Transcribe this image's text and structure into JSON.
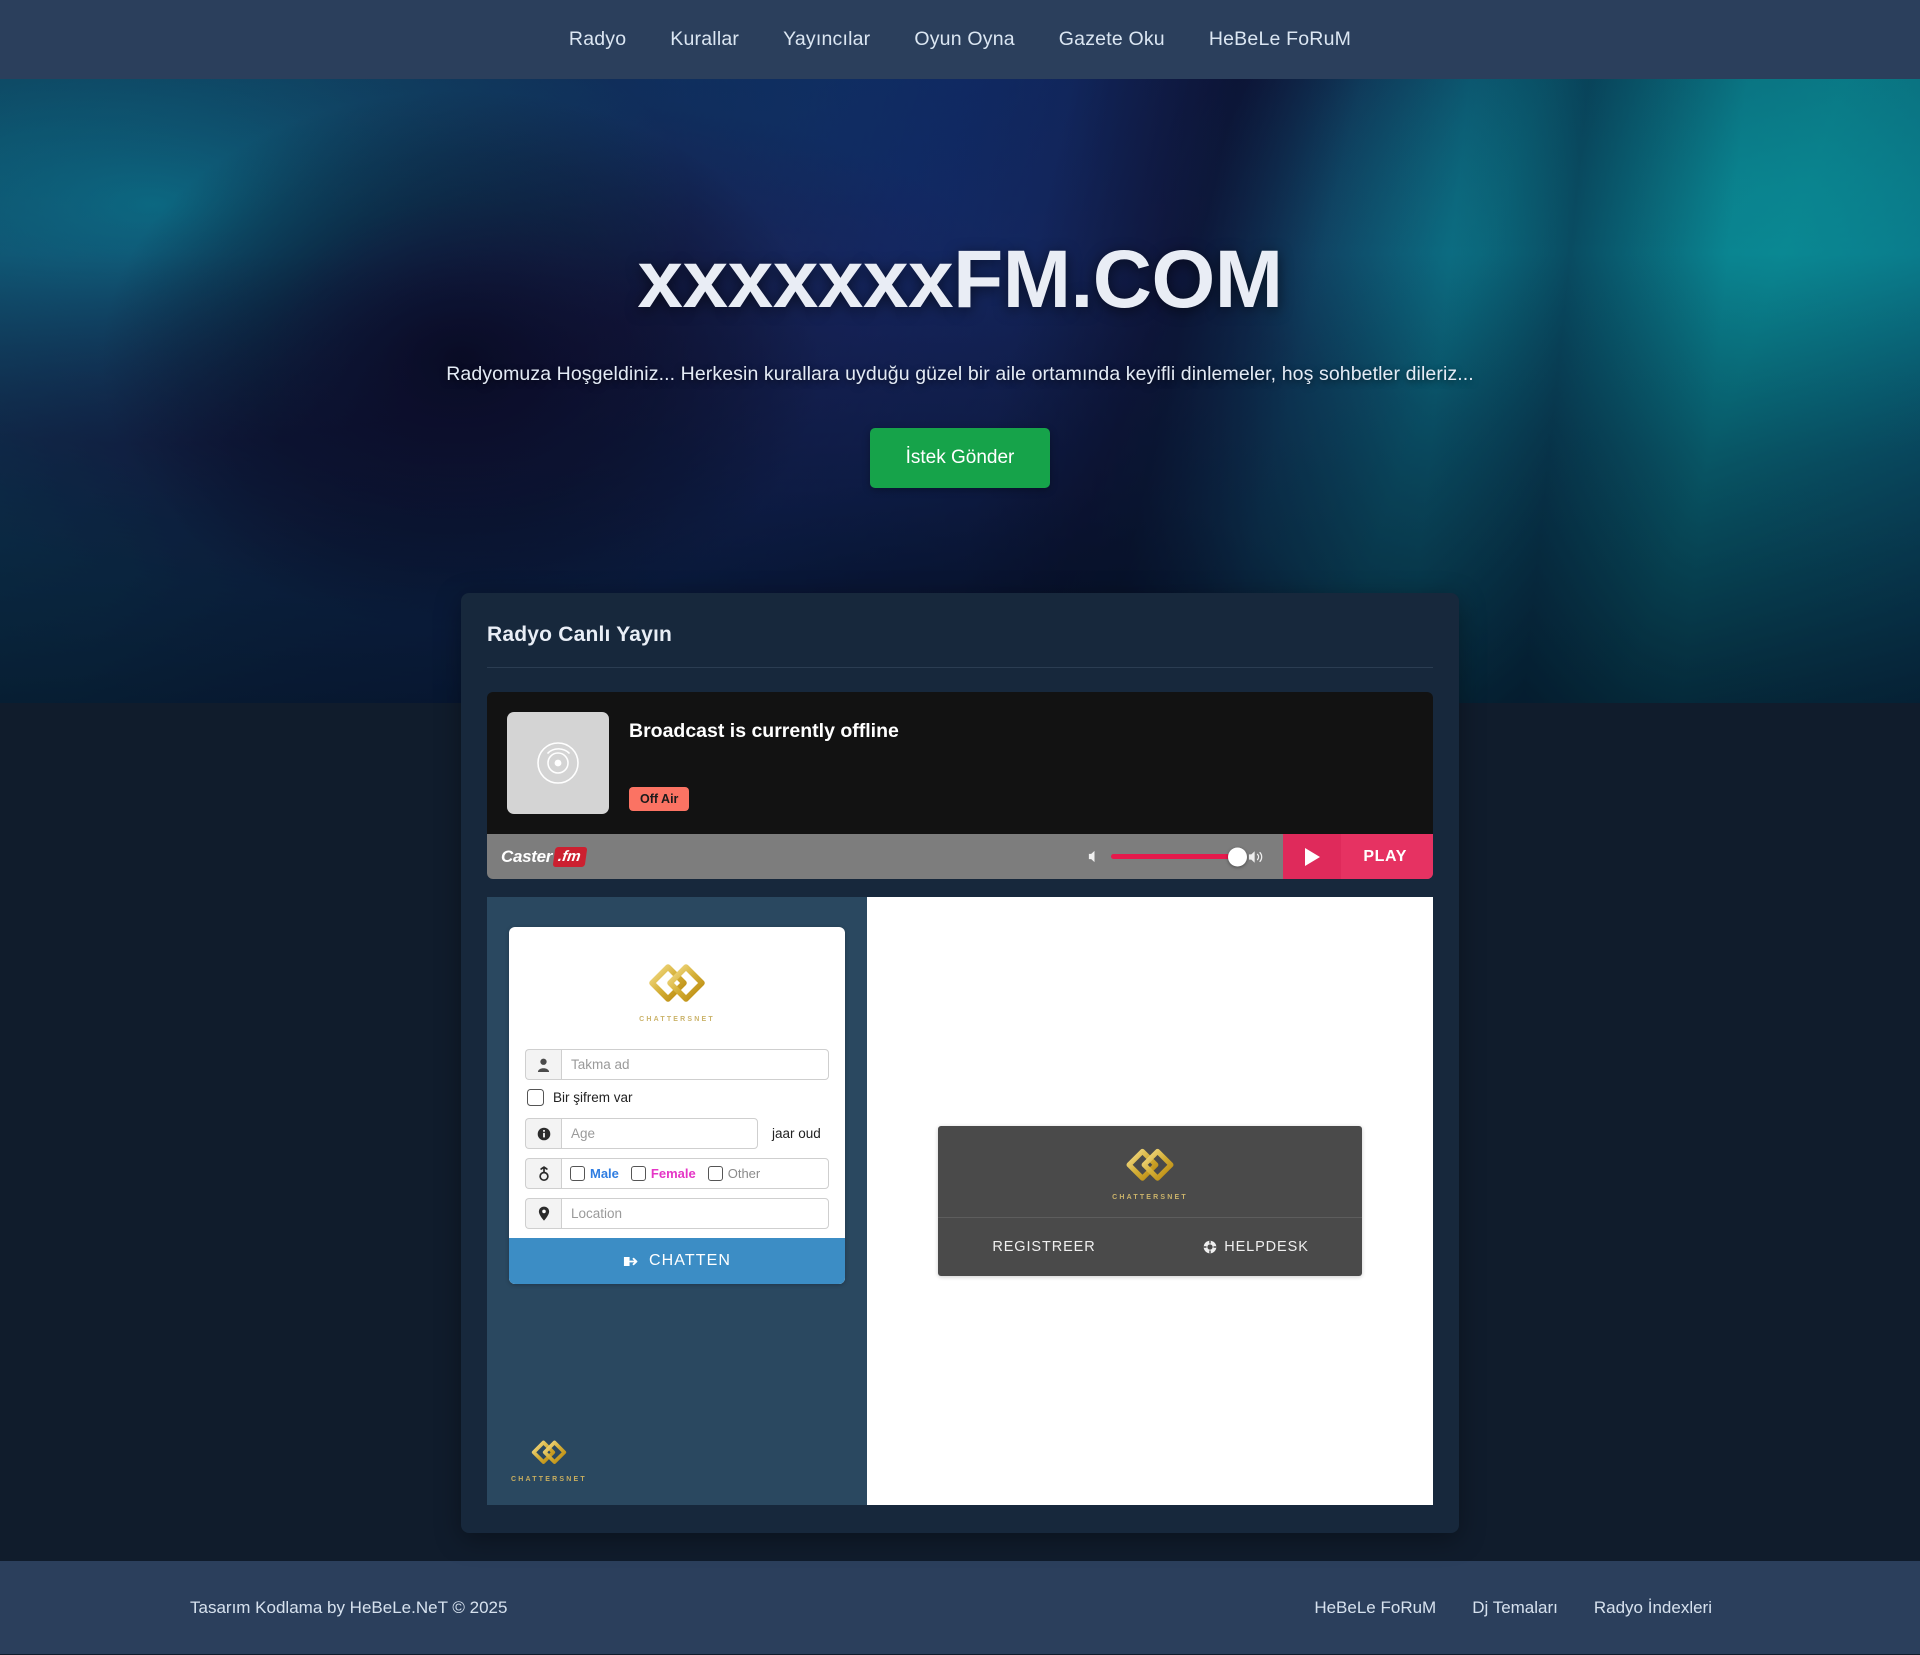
{
  "nav": {
    "items": [
      {
        "label": "Radyo",
        "name": "nav-link-radyo"
      },
      {
        "label": "Kurallar",
        "name": "nav-link-kurallar"
      },
      {
        "label": "Yayıncılar",
        "name": "nav-link-yayincilar"
      },
      {
        "label": "Oyun Oyna",
        "name": "nav-link-oyun-oyna"
      },
      {
        "label": "Gazete Oku",
        "name": "nav-link-gazete-oku"
      },
      {
        "label": "HeBeLe FoRuM",
        "name": "nav-link-hebele-forum"
      }
    ]
  },
  "hero": {
    "title": "xxxxxxxFM.COM",
    "subtitle": "Radyomuza Hoşgeldiniz... Herkesin kurallara uyduğu güzel bir aile ortamında keyifli dinlemeler, hoş sohbetler dileriz...",
    "cta_label": "İstek Gönder",
    "cta_color": "#16a34a"
  },
  "radio_card": {
    "title": "Radyo Canlı Yayın",
    "player": {
      "status_text": "Broadcast is currently offline",
      "badge_label": "Off Air",
      "badge_color": "#fb7363",
      "album_icon": "vinyl-disc-icon",
      "brand_word": "Caster",
      "brand_suffix": ".fm",
      "brand_accent": "#cc2030",
      "play_label": "PLAY",
      "play_color": "#e63262",
      "volume_percent": 100
    }
  },
  "chat": {
    "logo_caption": "CHATTERSNET",
    "nickname_placeholder": "Takma ad",
    "nickname_value": "",
    "password_checkbox_label": "Bir şifrem var",
    "age_placeholder": "Age",
    "age_value": "",
    "age_suffix": "jaar oud",
    "gender": [
      {
        "label": "Male",
        "color": "#2f7de1",
        "name": "gender-option-male"
      },
      {
        "label": "Female",
        "color": "#e535c6",
        "name": "gender-option-female"
      },
      {
        "label": "Other",
        "color": "#8b8b8b",
        "name": "gender-option-other"
      }
    ],
    "location_placeholder": "Location",
    "location_value": "",
    "submit_label": "CHATTEN",
    "submit_color": "#3c8dc5",
    "panel": {
      "logo_caption": "CHATTERSNET",
      "register_label": "REGISTREER",
      "helpdesk_label": "HELPDESK"
    }
  },
  "footer": {
    "copyright": "Tasarım Kodlama by HeBeLe.NeT © 2025",
    "links": [
      {
        "label": "HeBeLe FoRuM",
        "name": "footer-link-hebele-forum"
      },
      {
        "label": "Dj Temaları",
        "name": "footer-link-dj-temalari"
      },
      {
        "label": "Radyo İndexleri",
        "name": "footer-link-radyo-indexleri"
      }
    ]
  }
}
